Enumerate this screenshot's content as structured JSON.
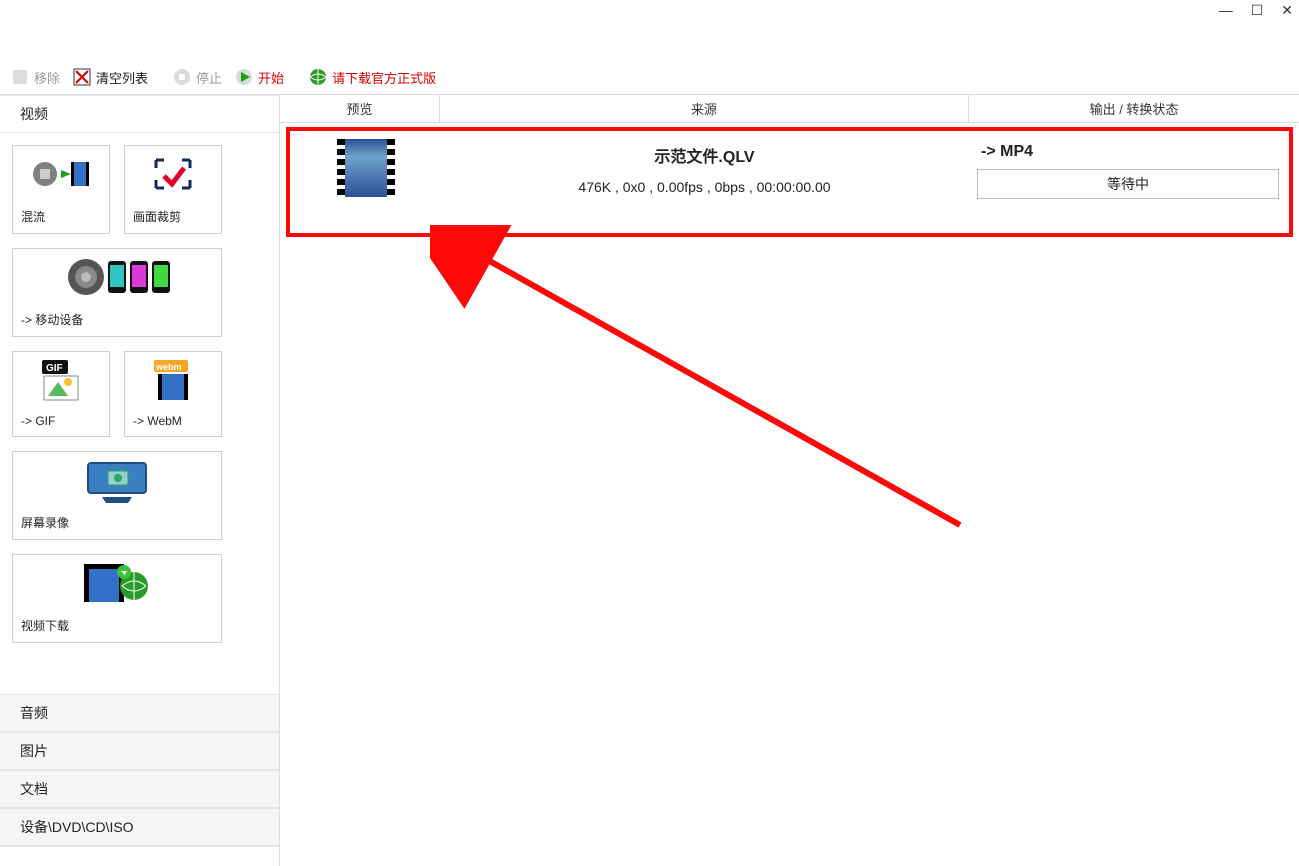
{
  "window": {
    "min": "—",
    "max": "☐",
    "close": "✕"
  },
  "toolbar": {
    "remove": "移除",
    "clear": "清空列表",
    "stop": "停止",
    "start": "开始",
    "download_official": "请下载官方正式版"
  },
  "sidebar": {
    "sections": {
      "video": "视频",
      "audio": "音频",
      "image": "图片",
      "document": "文档",
      "device": "设备\\DVD\\CD\\ISO"
    },
    "tiles": {
      "mux": "混流",
      "crop": "画面裁剪",
      "mobile": "-> 移动设备",
      "gif": "-> GIF",
      "webm": "-> WebM",
      "screenrec": "屏幕录像",
      "download": "视频下载"
    }
  },
  "columns": {
    "preview": "预览",
    "source": "来源",
    "output": "输出 / 转换状态"
  },
  "item": {
    "filename": "示范文件.QLV",
    "meta": "476K , 0x0 , 0.00fps , 0bps , 00:00:00.00",
    "target": "-> MP4",
    "status": "等待中"
  }
}
